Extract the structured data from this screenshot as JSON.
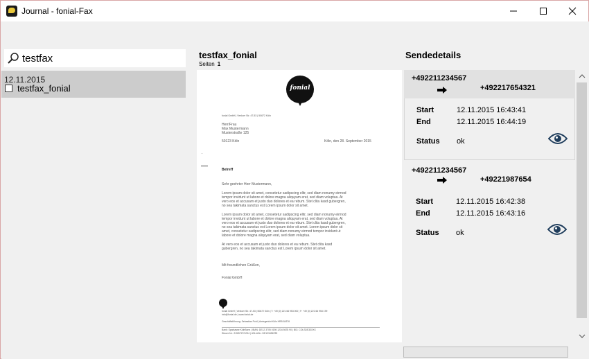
{
  "window": {
    "title": "Journal - fonial-Fax",
    "minimize_icon": "minimize-icon",
    "maximize_icon": "maximize-icon",
    "close_icon": "close-icon"
  },
  "search": {
    "value": "testfax",
    "icon": "search-icon"
  },
  "journal": {
    "items": [
      {
        "date": "12.11.2015",
        "name": "testfax_fonial",
        "checked": false
      }
    ]
  },
  "document": {
    "title": "testfax_fonial",
    "pages_label": "Seiten",
    "pages_count": "1",
    "preview": {
      "logo_text": "fonial",
      "sender_line": "fonial GmbH | Venloer Str. 47-53 | 50672 Köln",
      "recipient": [
        "Herr/Frau",
        "Max Mustermann",
        "Musterstraße 125"
      ],
      "city": "50123 Köln",
      "date": "Köln, den 28. September 2015",
      "subject": "Betreff",
      "greeting": "Sehr geehrter Herr Mustermann,",
      "para1": [
        "Lorem ipsum dolor sit amet, consetetur sadipscing elitr, sed diam nonumy eirmod",
        "tempor invidunt ut labore et dolore magna aliquyam erat, sed diam voluptua. At",
        "vero eos et accusam et justo duo dolores et ea rebum. Stet clita kasd gubergren,",
        "no sea takimata sanctus est Lorem ipsum dolor sit amet."
      ],
      "para2": [
        "Lorem ipsum dolor sit amet, consetetur sadipscing elitr, sed diam nonumy eirmod",
        "tempor invidunt ut labore et dolore magna aliquyam erat, sed diam voluptua. At",
        "vero eos et accusam et justo duo dolores et ea rebum. Stet clita kasd gubergren,",
        "no sea takimata sanctus est Lorem ipsum dolor sit amet. Lorem ipsum dolor sit",
        "amet, consetetur sadipscing elitr, sed diam nonumy eirmod tempor invidunt ut",
        "labore et dolore magna aliquyam erat, sed diam voluptua."
      ],
      "para3": [
        "At vero eos et accusam et justo duo dolores et ea rebum. Stet clita kasd",
        "gubergren, no sea takimata sanctus est Lorem ipsum dolor sit amet."
      ],
      "closing": "Mit freundlichen Grüßen,",
      "signature": "Fonial GmbH",
      "footer": [
        "fonial GmbH | Venloer Str. 47-53 | 50672 Köln | T: +49 (0) 221 66 953 000 | F: +49 (0) 221 66 953 199",
        "info@fonial.de | www.fonial.de",
        "Geschäftsführung: Sebastian Pohl | Amtsgericht Köln HRB 84376",
        "Bank: Sparkasse KölnBonn | IBAN: DE12 3705 0198 1234 5678 90 | BIC: COLSDE33XXX",
        "Steuer-Nr.: 215/5727/1234 | USt-IdNr.: DE123456789"
      ]
    }
  },
  "details": {
    "title": "Sendedetails",
    "start_label": "Start",
    "end_label": "End",
    "status_label": "Status",
    "arrow_icon": "arrow-right-icon",
    "view_icon": "eye-icon",
    "entries": [
      {
        "from": "+492211234567",
        "to": "+492217654321",
        "start": "12.11.2015 16:43:41",
        "end": "12.11.2015 16:44:19",
        "status": "ok"
      },
      {
        "from": "+492211234567",
        "to": "+49221987654",
        "start": "12.11.2015 16:42:38",
        "end": "12.11.2015 16:43:16",
        "status": "ok"
      }
    ]
  }
}
